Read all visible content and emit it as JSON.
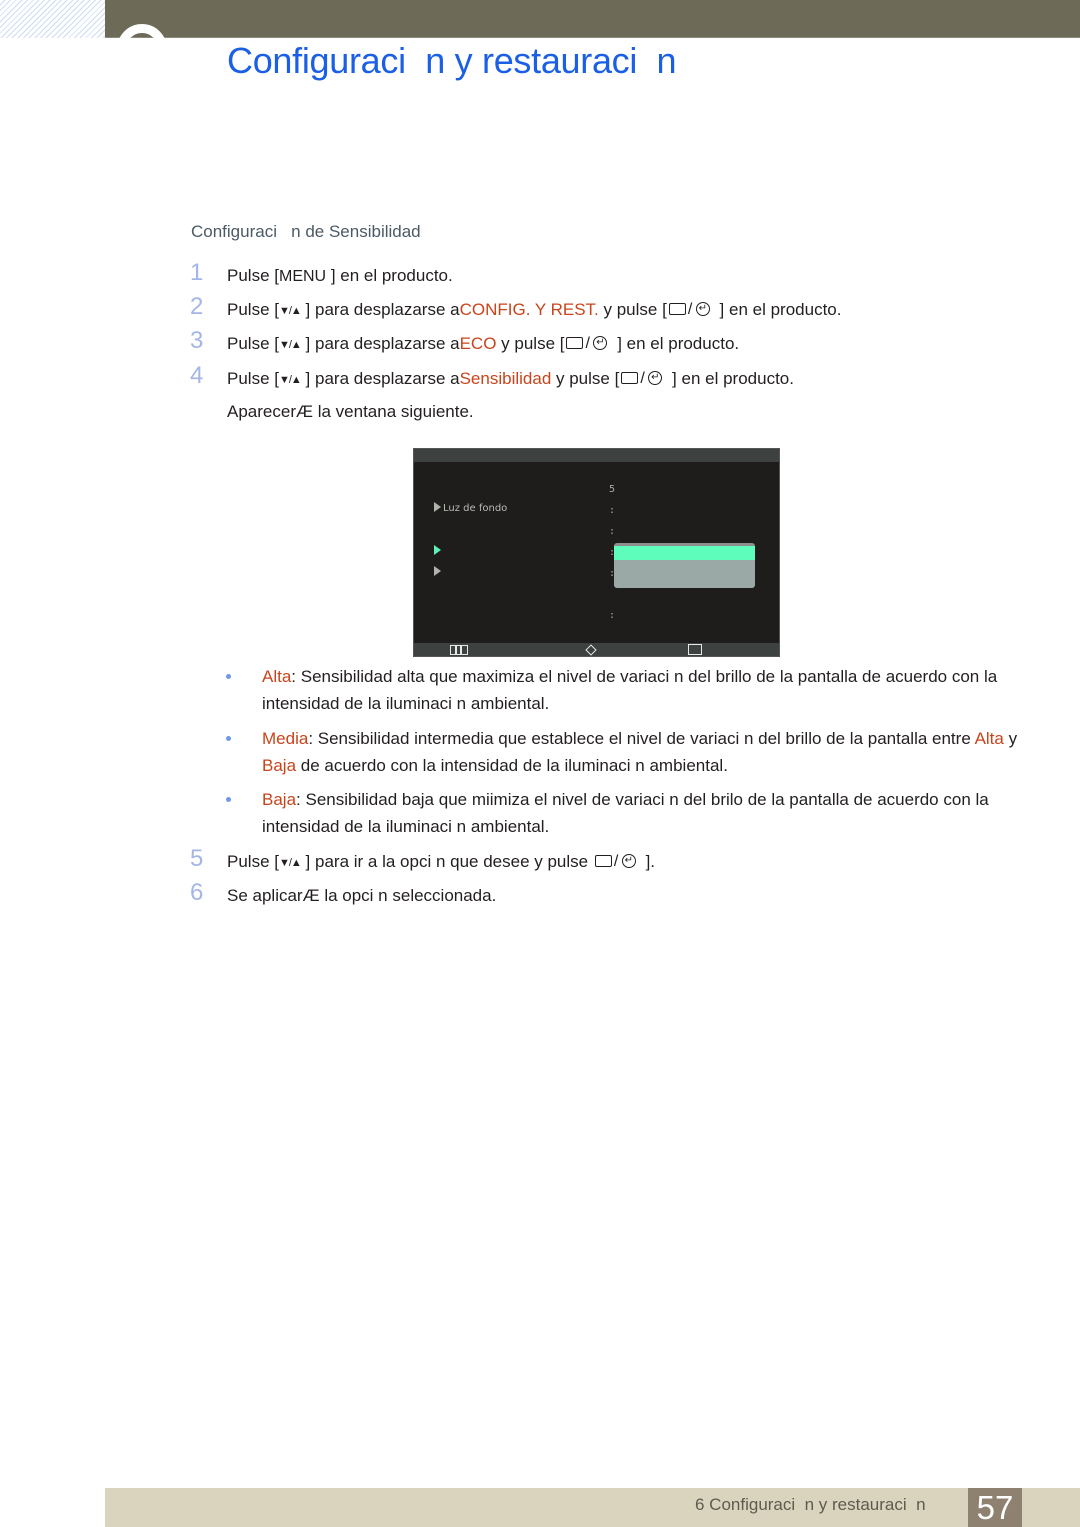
{
  "header": {
    "title": "Configuraci  n y restauraci  n"
  },
  "section": {
    "title": "Configuraci   n de Sensibilidad"
  },
  "steps": [
    {
      "num": "1",
      "parts": {
        "a": "Pulse [",
        "key": "MENU",
        "b": " ] en el producto."
      }
    },
    {
      "num": "2",
      "parts": {
        "a": "Pulse [",
        "arrows": "▼/▲",
        "b": " ] para desplazarse a",
        "hl": "CONFIG. Y REST.",
        "c": " y pulse [",
        "d": " ] en el producto."
      }
    },
    {
      "num": "3",
      "parts": {
        "a": "Pulse [",
        "arrows": "▼/▲",
        "b": " ] para desplazarse a",
        "hl": "ECO",
        "c": " y pulse [",
        "d": " ] en el producto."
      }
    },
    {
      "num": "4",
      "parts": {
        "a": "Pulse [",
        "arrows": "▼/▲",
        "b": " ] para desplazarse a",
        "hl": "Sensibilidad",
        "c": " y pulse [",
        "d": " ] en el producto."
      }
    },
    {
      "num": "",
      "parts": {
        "a": "AparecerÆ la ventana siguiente."
      }
    },
    {
      "num": "5",
      "parts": {
        "a": "Pulse [",
        "arrows": "▼/▲",
        "b": " ] para ir a la opci n que desee y pulse ",
        "d": " ]."
      }
    },
    {
      "num": "6",
      "parts": {
        "a": "Se aplicarÆ la opci n seleccionada."
      }
    }
  ],
  "osd": {
    "items": [
      {
        "label": "Luz de fondo",
        "active": false
      },
      {
        "label": "",
        "active": true
      },
      {
        "label": "",
        "active": false
      }
    ],
    "values": [
      "5",
      ":",
      ":",
      ":",
      ":",
      ":"
    ],
    "bottom_icons": [
      "menu-icon",
      "navigate-icon",
      "enter-icon"
    ]
  },
  "bullets": [
    {
      "term": "Alta",
      "text": ": Sensibilidad alta que maximiza el nivel de variaci n del brillo de la pantalla de acuerdo con la intensidad de la iluminaci n ambiental."
    },
    {
      "term": "Media",
      "text": ": Sensibilidad intermedia que establece el nivel de variaci n del brillo de la pantalla entre ",
      "term2": "Alta",
      "mid": " y ",
      "term3": "Baja",
      "text2": " de acuerdo con la intensidad de la iluminaci n ambiental."
    },
    {
      "term": "Baja",
      "text": ": Sensibilidad baja que miimiza el nivel de variaci n del brilo de la pantalla de acuerdo con la intensidad de la iluminaci n ambiental."
    }
  ],
  "footer": {
    "chapter": "6 Configuraci  n y restauraci  n",
    "page": "57"
  }
}
